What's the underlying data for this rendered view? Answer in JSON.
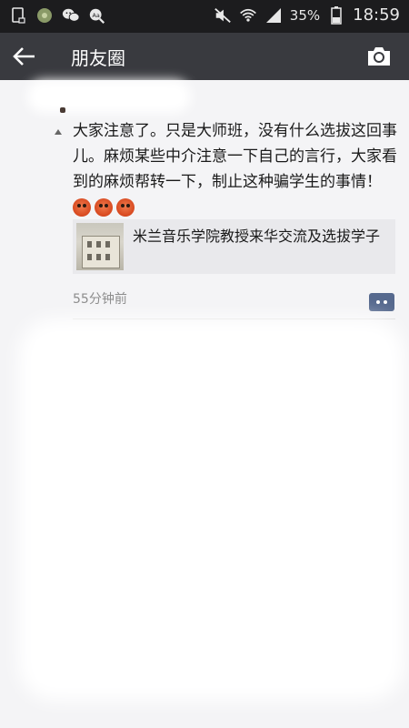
{
  "status_bar": {
    "battery_percent": "35%",
    "time": "18:59",
    "icons": [
      "phone-outline-icon",
      "app-badge-icon",
      "wechat-icon",
      "search-app-icon",
      "mute-icon",
      "wifi-icon",
      "signal-icon",
      "battery-icon"
    ]
  },
  "app_bar": {
    "title": "朋友圈",
    "back_icon": "back-arrow-icon",
    "camera_icon": "camera-icon"
  },
  "post": {
    "text": "大家注意了。只是大师班，没有什么选拔这回事儿。麻烦某些中介注意一下自己的言行，大家看到的麻烦帮转一下，制止这种骗学生的事情！",
    "emojis": [
      "angry-face-icon",
      "angry-face-icon",
      "angry-face-icon"
    ],
    "link": {
      "title": "米兰音乐学院教授来华交流及选拔学子",
      "thumbnail_icon": "building-thumbnail"
    },
    "timestamp": "55分钟前",
    "comment_icon": "comment-icon"
  },
  "colors": {
    "status_bar_bg": "#1c1c1e",
    "app_bar_bg": "#393a3f",
    "content_bg": "#f4f4f6",
    "link_card_bg": "#e9e9ec",
    "comment_button": "#56698e"
  }
}
